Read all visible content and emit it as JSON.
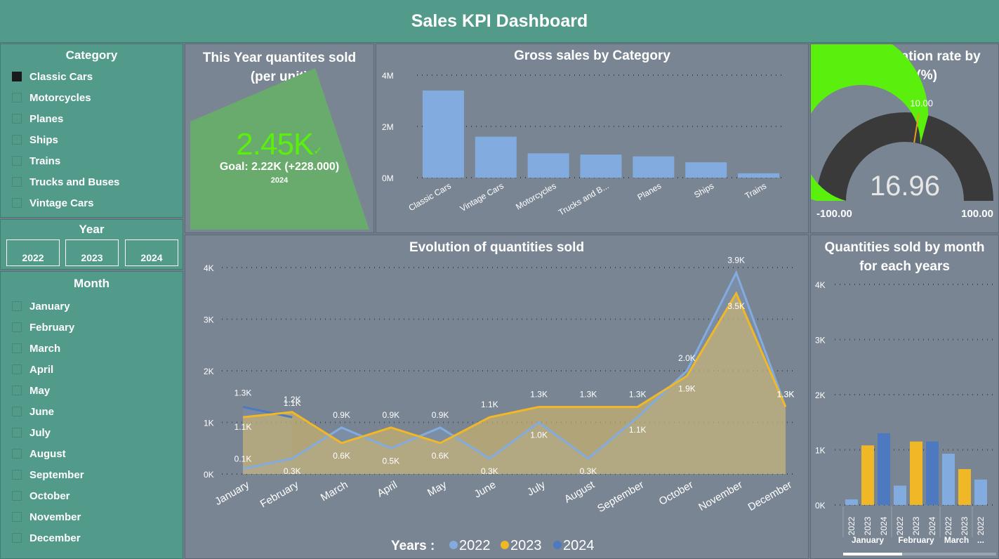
{
  "title": "Sales KPI Dashboard",
  "colors": {
    "header": "#529a8a",
    "slicer": "#529a8a",
    "panel": "#7a8593",
    "bar": "#82ace0",
    "y2022": "#82ace0",
    "y2023": "#f0b827",
    "y2024": "#4d79c0",
    "gauge_fill": "#5bef0e",
    "gauge_rest": "#3a3a3a",
    "kpi": "#5bef0e"
  },
  "category_slicer": {
    "title": "Category",
    "items": [
      {
        "label": "Classic Cars",
        "selected": true
      },
      {
        "label": "Motorcycles",
        "selected": false
      },
      {
        "label": "Planes",
        "selected": false
      },
      {
        "label": "Ships",
        "selected": false
      },
      {
        "label": "Trains",
        "selected": false
      },
      {
        "label": "Trucks and Buses",
        "selected": false
      },
      {
        "label": "Vintage Cars",
        "selected": false
      }
    ]
  },
  "year_slicer": {
    "title": "Year",
    "items": [
      "2022",
      "2023",
      "2024"
    ]
  },
  "month_slicer": {
    "title": "Month",
    "items": [
      "January",
      "February",
      "March",
      "April",
      "May",
      "June",
      "July",
      "August",
      "September",
      "October",
      "November",
      "December"
    ]
  },
  "kpi": {
    "title": "This Year quantites sold (per unit)",
    "value": "2.45K",
    "check_icon": "check-icon",
    "goal": "Goal: 2.22K (+228.000)",
    "year": "2024"
  },
  "gauge": {
    "title": "Annual variation rate by month (%)",
    "value": "16.96",
    "value_num": 16.96,
    "min": "-100.00",
    "max": "100.00",
    "min_num": -100,
    "max_num": 100,
    "target": "10.00",
    "target_num": 10
  },
  "chart_data": [
    {
      "type": "bar",
      "title": "Gross sales by Category",
      "categories": [
        "Classic Cars",
        "Vintage Cars",
        "Motorcycles",
        "Trucks and B...",
        "Planes",
        "Ships",
        "Trains"
      ],
      "values": [
        3.4,
        1.6,
        0.95,
        0.9,
        0.83,
        0.6,
        0.17
      ],
      "unit": "M",
      "ylim": [
        0,
        4
      ],
      "yticks": [
        "0M",
        "2M",
        "4M"
      ],
      "grid": true
    },
    {
      "type": "area",
      "title": "Evolution of quantities sold",
      "categories": [
        "January",
        "February",
        "March",
        "April",
        "May",
        "June",
        "July",
        "August",
        "September",
        "October",
        "November",
        "December"
      ],
      "ylim": [
        0,
        4
      ],
      "yticks": [
        "0K",
        "1K",
        "2K",
        "3K",
        "4K"
      ],
      "legend_title": "Years :",
      "legend_position": "bottom",
      "series": [
        {
          "name": "2022",
          "values": [
            0.1,
            0.3,
            0.9,
            0.5,
            0.9,
            0.3,
            1.0,
            0.3,
            1.1,
            2.0,
            3.9,
            1.3
          ],
          "labels": [
            "0.1K",
            "0.3K",
            "0.9K",
            "0.5K",
            "0.9K",
            "0.3K",
            "1.0K",
            "0.3K",
            "1.1K",
            "2.0K",
            "3.9K",
            "1.3K"
          ]
        },
        {
          "name": "2023",
          "values": [
            1.1,
            1.2,
            0.6,
            0.9,
            0.6,
            1.1,
            1.3,
            1.3,
            1.3,
            1.9,
            3.5,
            1.3
          ],
          "labels": [
            "1.1K",
            "1.2K",
            "0.6K",
            "0.9K",
            "0.6K",
            "1.1K",
            "1.3K",
            "1.3K",
            "1.3K",
            "1.9K",
            "3.5K",
            "1.3K"
          ]
        },
        {
          "name": "2024",
          "values": [
            1.3,
            1.1,
            null,
            null,
            null,
            null,
            null,
            null,
            null,
            null,
            null,
            null
          ],
          "labels": [
            "1.3K",
            "1.1K",
            "",
            "",
            "",
            "",
            "",
            "",
            "",
            "",
            "",
            ""
          ]
        }
      ]
    },
    {
      "type": "bar",
      "title": "Quantities sold by month for each years",
      "ylim": [
        0,
        4
      ],
      "yticks": [
        "0K",
        "1K",
        "2K",
        "3K",
        "4K"
      ],
      "groups": [
        {
          "month": "January",
          "bars": [
            {
              "year": "2022",
              "value": 0.1
            },
            {
              "year": "2023",
              "value": 1.08
            },
            {
              "year": "2024",
              "value": 1.3
            }
          ]
        },
        {
          "month": "February",
          "bars": [
            {
              "year": "2022",
              "value": 0.35
            },
            {
              "year": "2023",
              "value": 1.15
            },
            {
              "year": "2024",
              "value": 1.15
            }
          ]
        },
        {
          "month": "March",
          "bars": [
            {
              "year": "2022",
              "value": 0.93
            },
            {
              "year": "2023",
              "value": 0.65
            }
          ]
        },
        {
          "month": "...",
          "bars": [
            {
              "year": "2022",
              "value": 0.46
            }
          ]
        }
      ]
    }
  ]
}
